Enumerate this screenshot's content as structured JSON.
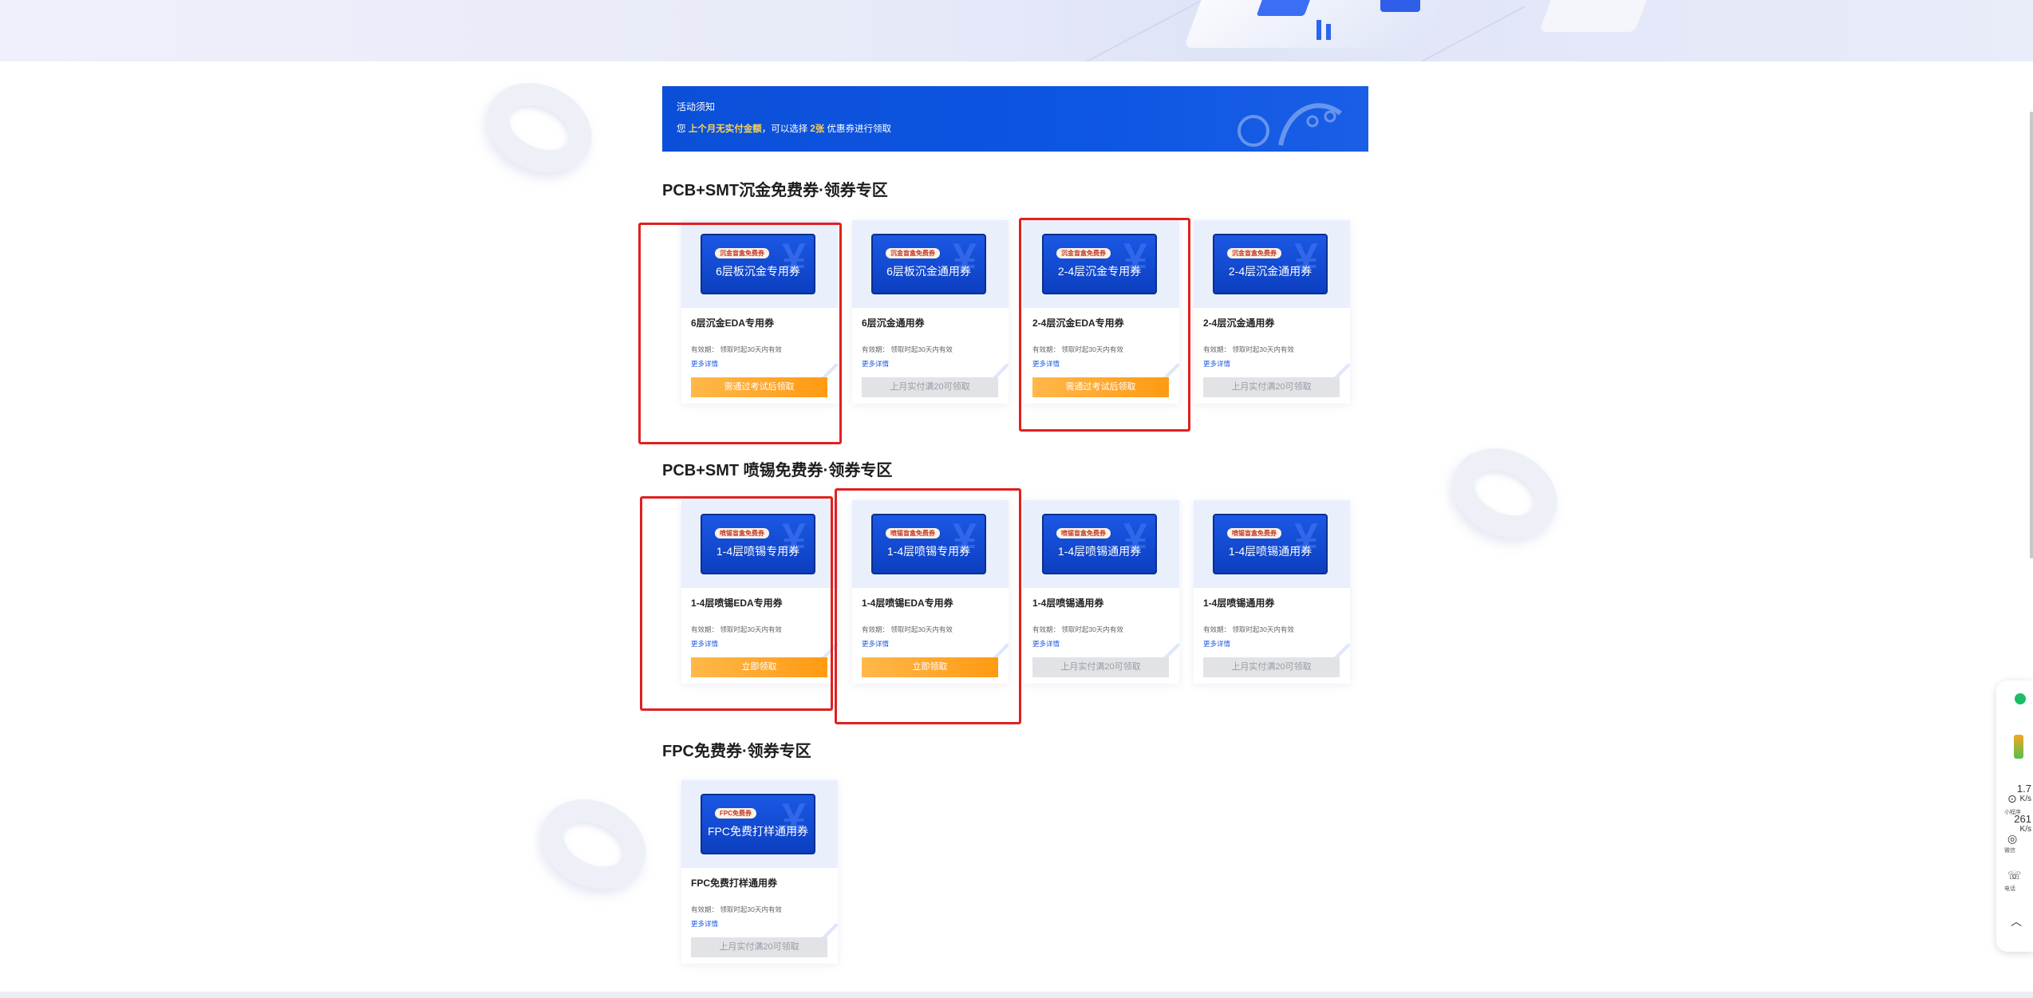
{
  "notice": {
    "title": "活动须知",
    "desc_prefix": "您",
    "desc_highlight1": "上个月无实付金额",
    "desc_mid": "，可以选择",
    "desc_highlight2": "2张",
    "desc_suffix": "优惠券进行领取"
  },
  "sections": [
    {
      "title": "PCB+SMT沉金免费券·领券专区",
      "cards": [
        {
          "tag": "沉金盲盒免费券",
          "ticket": "6层板沉金专用券",
          "name": "6层沉金EDA专用券",
          "valid": "有效期：   领取时起30天内有效",
          "more": "更多详情",
          "button": "需通过考试后领取",
          "button_style": "orange"
        },
        {
          "tag": "沉金盲盒免费券",
          "ticket": "6层板沉金通用券",
          "name": "6层沉金通用券",
          "valid": "有效期：   领取时起30天内有效",
          "more": "更多详情",
          "button": "上月实付满20可领取",
          "button_style": "gray"
        },
        {
          "tag": "沉金盲盒免费券",
          "ticket": "2-4层沉金专用券",
          "name": "2-4层沉金EDA专用券",
          "valid": "有效期：   领取时起30天内有效",
          "more": "更多详情",
          "button": "需通过考试后领取",
          "button_style": "orange"
        },
        {
          "tag": "沉金盲盒免费券",
          "ticket": "2-4层沉金通用券",
          "name": "2-4层沉金通用券",
          "valid": "有效期：   领取时起30天内有效",
          "more": "更多详情",
          "button": "上月实付满20可领取",
          "button_style": "gray"
        }
      ]
    },
    {
      "title": "PCB+SMT 喷锡免费券·领券专区",
      "cards": [
        {
          "tag": "喷锡盲盒免费券",
          "ticket": "1-4层喷锡专用券",
          "name": "1-4层喷锡EDA专用券",
          "valid": "有效期：   领取时起30天内有效",
          "more": "更多详情",
          "button": "立即领取",
          "button_style": "orange"
        },
        {
          "tag": "喷锡盲盒免费券",
          "ticket": "1-4层喷锡专用券",
          "name": "1-4层喷锡EDA专用券",
          "valid": "有效期：   领取时起30天内有效",
          "more": "更多详情",
          "button": "立即领取",
          "button_style": "orange"
        },
        {
          "tag": "喷锡盲盒免费券",
          "ticket": "1-4层喷锡通用券",
          "name": "1-4层喷锡通用券",
          "valid": "有效期：   领取时起30天内有效",
          "more": "更多详情",
          "button": "上月实付满20可领取",
          "button_style": "gray"
        },
        {
          "tag": "喷锡盲盒免费券",
          "ticket": "1-4层喷锡通用券",
          "name": "1-4层喷锡通用券",
          "valid": "有效期：   领取时起30天内有效",
          "more": "更多详情",
          "button": "上月实付满20可领取",
          "button_style": "gray"
        }
      ]
    },
    {
      "title": "FPC免费券·领券专区",
      "cards": [
        {
          "tag": "FPC免费券",
          "ticket": "FPC免费打样通用券",
          "name": "FPC免费打样通用券",
          "valid": "有效期：   领取时起30天内有效",
          "more": "更多详情",
          "button": "上月实付满20可领取",
          "button_style": "gray"
        }
      ]
    }
  ],
  "float_panel": {
    "value1": "1.7",
    "unit1": "K/s",
    "value2": "261",
    "unit2": "K/s",
    "label1": "小程序",
    "label2": "微信",
    "label3": "电话"
  },
  "colors": {
    "accent_blue": "#0d56e2",
    "button_orange": "#ff9a12",
    "highlight_red": "#e02020"
  }
}
